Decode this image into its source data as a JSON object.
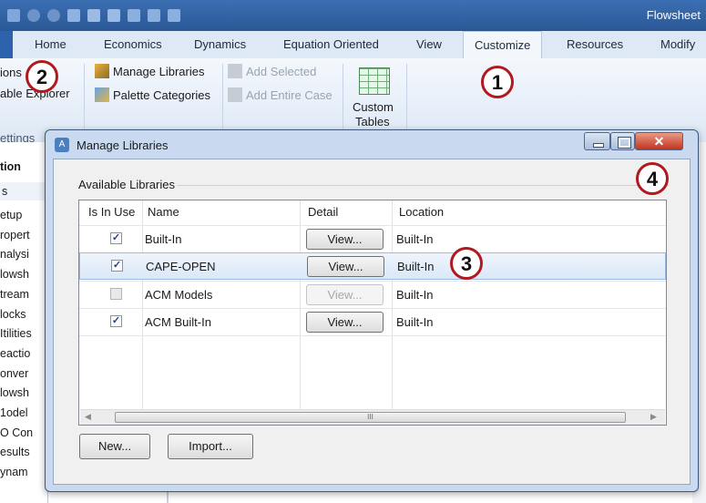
{
  "window": {
    "title_fragment": "Flowsheet"
  },
  "ribbon": {
    "tabs": [
      "Home",
      "Economics",
      "Dynamics",
      "Equation Oriented",
      "View",
      "Customize",
      "Resources",
      "Modify"
    ],
    "active_tab": "Customize",
    "left_fragments": [
      "ions",
      "able Explorer",
      "ettings"
    ],
    "manage_libraries": "Manage Libraries",
    "palette_categories": "Palette Categories",
    "add_selected": "Add Selected",
    "add_entire_case": "Add Entire Case",
    "custom_tables_line1": "Custom",
    "custom_tables_line2": "Tables"
  },
  "left_panel": {
    "header": "tion",
    "search": "s",
    "items": [
      "etup",
      "ropert",
      "nalysi",
      "lowsh",
      "tream",
      "locks",
      "Itilities",
      "eactio",
      "onver",
      "lowsh",
      "1odel",
      "O Con",
      "esults",
      "ynam"
    ]
  },
  "dialog": {
    "title": "Manage Libraries",
    "group_label": "Available Libraries",
    "columns": [
      "Is In Use",
      "Name",
      "Detail",
      "Location"
    ],
    "rows": [
      {
        "in_use": "✓",
        "name": "Built-In",
        "detail": "View...",
        "location": "Built-In"
      },
      {
        "in_use": "✓",
        "name": "CAPE-OPEN",
        "detail": "View...",
        "location": "Built-In"
      },
      {
        "in_use": "",
        "name": "ACM Models",
        "detail": "View...",
        "location": "Built-In"
      },
      {
        "in_use": "✓",
        "name": "ACM Built-In",
        "detail": "View...",
        "location": "Built-In"
      }
    ],
    "scroll_grip": "III",
    "new_button": "New...",
    "import_button": "Import..."
  },
  "callouts": [
    "1",
    "2",
    "3",
    "4"
  ],
  "colors": {
    "callout_ring": "#b0191e",
    "title_bar": "#2f60a4",
    "selected_row": "#dbe8f8"
  }
}
